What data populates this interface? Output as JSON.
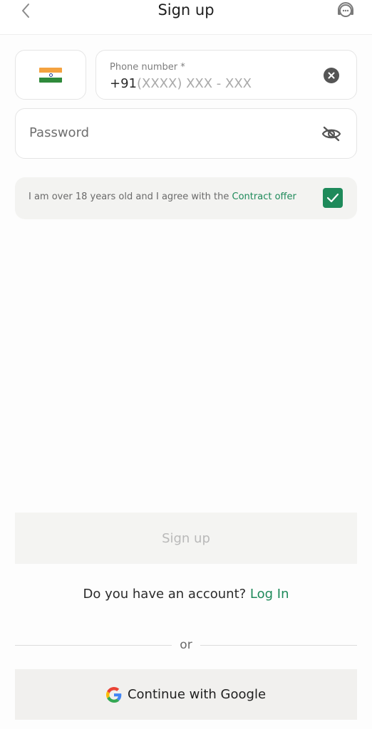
{
  "header": {
    "title": "Sign up",
    "back_icon": "chevron-left-icon",
    "support_icon": "headset-support-icon"
  },
  "country": {
    "flag": "india-flag-icon"
  },
  "phone": {
    "label": "Phone number *",
    "prefix": "+91",
    "mask": "(XXXX) XXX - XXX",
    "clear_icon": "clear-circle-x-icon"
  },
  "password": {
    "placeholder": "Password",
    "visibility_icon": "eye-slash-icon"
  },
  "agreement": {
    "text": "I am over 18 years old and I agree with the ",
    "link": "Contract offer",
    "checked": true,
    "check_icon": "checkmark-icon"
  },
  "signup_button": {
    "label": "Sign up"
  },
  "login_prompt": {
    "text": "Do you have an account? ",
    "link": "Log In"
  },
  "divider": {
    "label": "or"
  },
  "google_button": {
    "label": "Continue with Google",
    "icon": "google-g-icon"
  },
  "colors": {
    "accent": "#1e8a5a",
    "disabled_text": "#b9b9b9",
    "surface": "#f3f3f1"
  }
}
